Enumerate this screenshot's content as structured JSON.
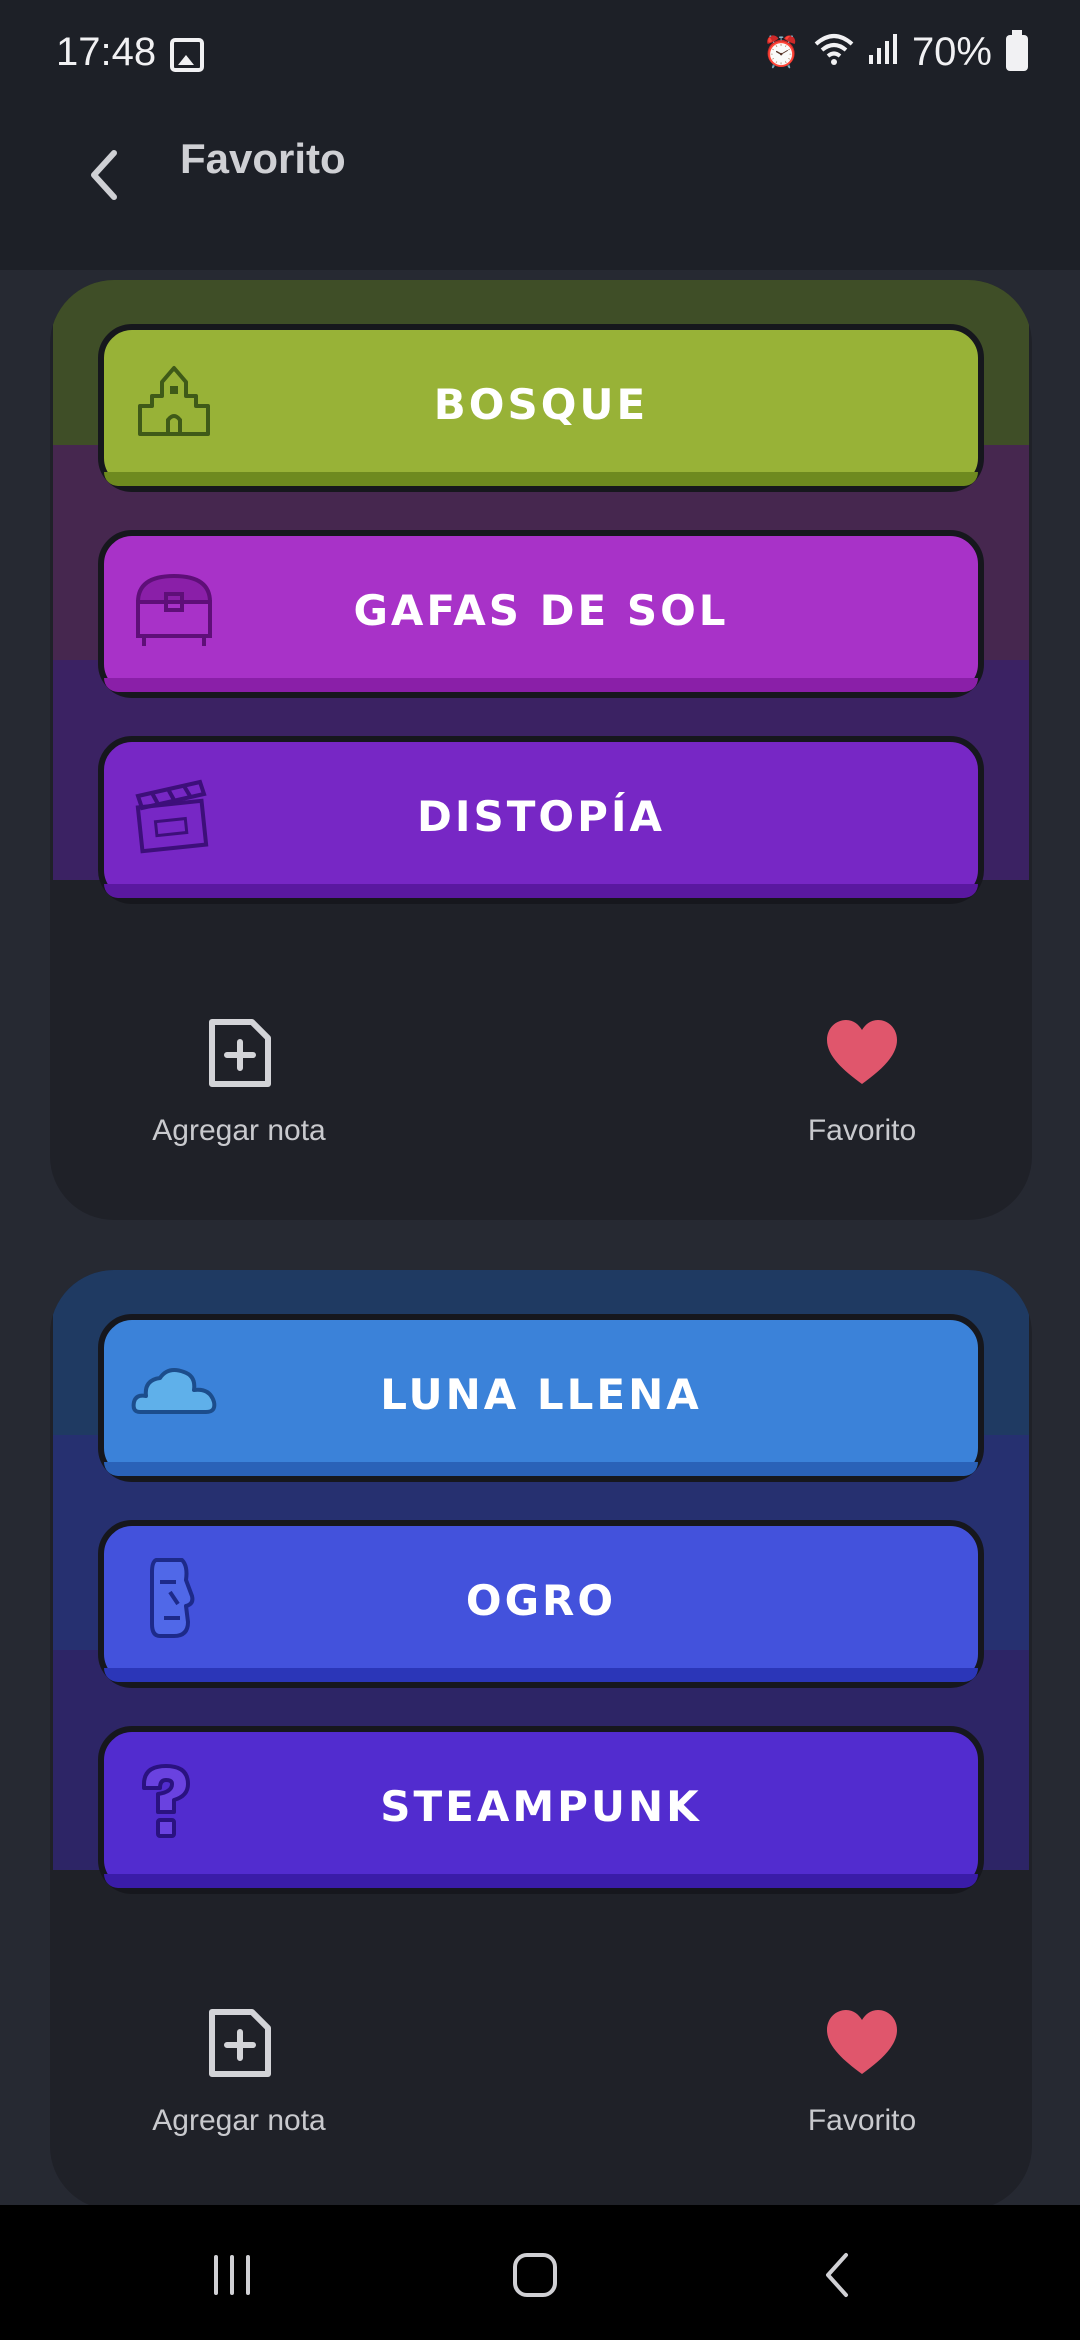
{
  "status_bar": {
    "time": "17:48",
    "battery": "70%",
    "icons": [
      "gallery-icon",
      "alarm-icon",
      "wifi-icon",
      "signal-icon",
      "battery-icon"
    ]
  },
  "appbar": {
    "title": "Favorito"
  },
  "cards": [
    {
      "header_color": "#3f4e27",
      "buttons": [
        {
          "label": "Bosque",
          "icon": "castle-icon",
          "color": "#98b237",
          "band_color": "#46274f"
        },
        {
          "label": "Gafas de sol",
          "icon": "treasure-chest-icon",
          "color": "#a832c8",
          "band_color": "#3b2263"
        },
        {
          "label": "Distopía",
          "icon": "clapperboard-icon",
          "color": "#7727c5",
          "band_color": "#3b2263"
        }
      ],
      "actions": {
        "add_note": "Agregar nota",
        "favorite": "Favorito"
      }
    },
    {
      "header_color": "#1f3a62",
      "buttons": [
        {
          "label": "Luna llena",
          "icon": "cloud-icon",
          "color": "#3b82d9",
          "band_color": "#263070"
        },
        {
          "label": "Ogro",
          "icon": "moai-icon",
          "color": "#4352dc",
          "band_color": "#2d2566"
        },
        {
          "label": "Steampunk",
          "icon": "question-mark-icon",
          "color": "#522ccf",
          "band_color": "#2d2566"
        }
      ],
      "actions": {
        "add_note": "Agregar nota",
        "favorite": "Favorito"
      }
    }
  ],
  "colors": {
    "favorite_heart": "#e0566c",
    "background": "#262932",
    "card": "#1f2128"
  }
}
